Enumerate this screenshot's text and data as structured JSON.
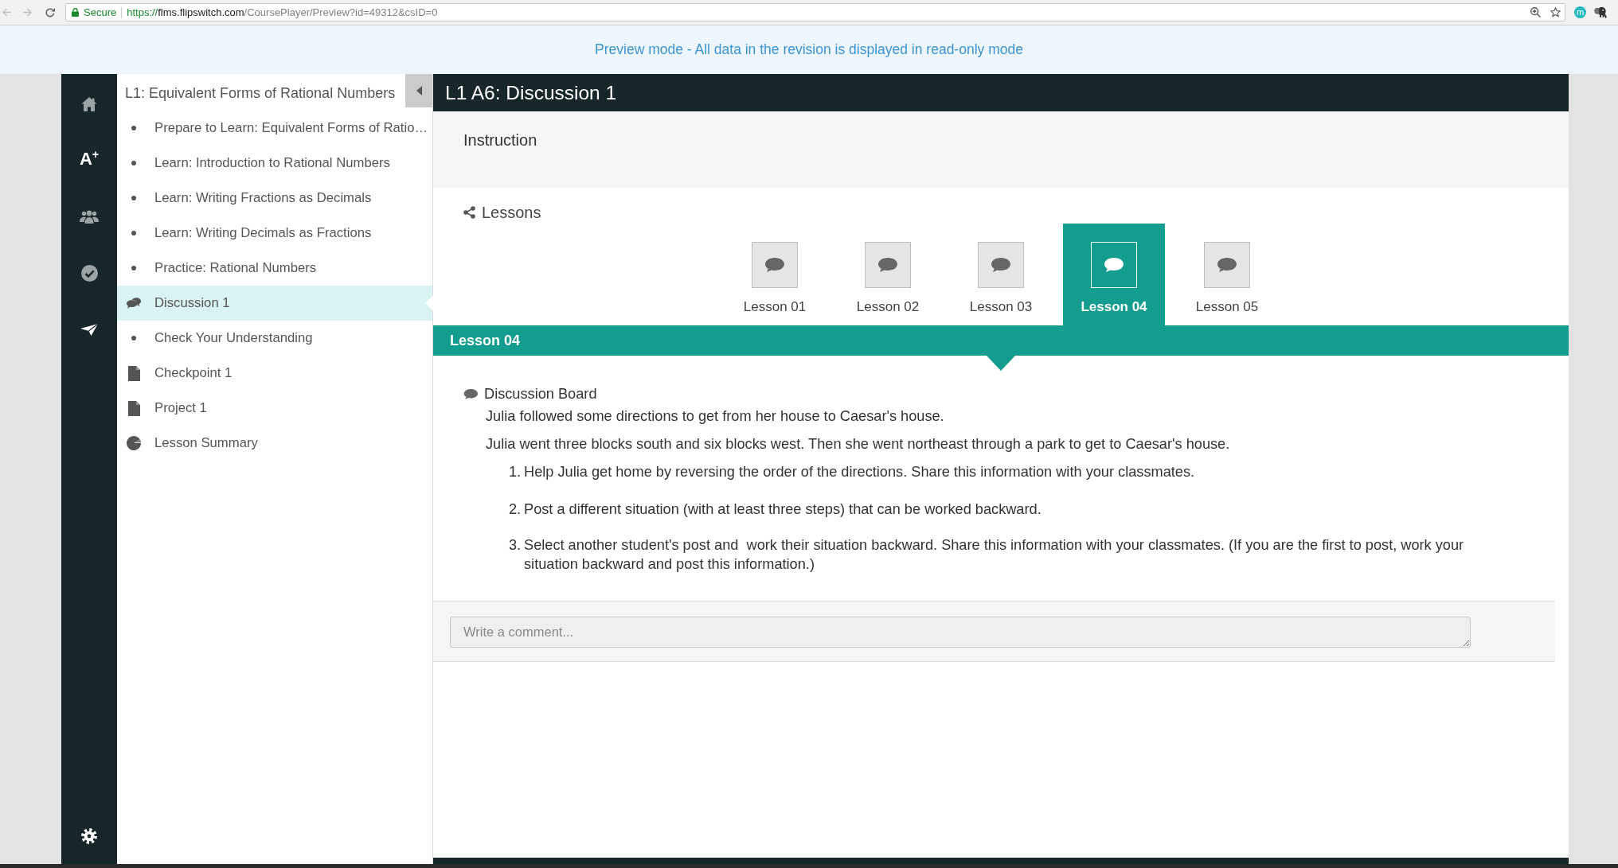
{
  "browser": {
    "security_label": "Secure",
    "url": {
      "scheme": "https://",
      "host": "flms.flipswitch.com",
      "path": "/CoursePlayer/Preview?id=49312&csID=0"
    },
    "extension_badge": "m"
  },
  "banner": {
    "text": "Preview mode - All data in the revision is displayed in read-only mode"
  },
  "nav_rail": {
    "grades_glyph": "A$^{+}$"
  },
  "sidebar": {
    "title": "L1: Equivalent Forms of Rational Numbers",
    "items": [
      {
        "kind": "bullet",
        "label": "Prepare to Learn: Equivalent Forms of Ratio…",
        "selected": false
      },
      {
        "kind": "bullet",
        "label": "Learn: Introduction to Rational Numbers",
        "selected": false
      },
      {
        "kind": "bullet",
        "label": "Learn: Writing Fractions as Decimals",
        "selected": false
      },
      {
        "kind": "bullet",
        "label": "Learn: Writing Decimals as Fractions",
        "selected": false
      },
      {
        "kind": "bullet",
        "label": "Practice: Rational Numbers",
        "selected": false
      },
      {
        "kind": "discussion",
        "label": "Discussion 1",
        "selected": true
      },
      {
        "kind": "bullet",
        "label": "Check Your Understanding",
        "selected": false
      },
      {
        "kind": "document",
        "label": "Checkpoint 1",
        "selected": false
      },
      {
        "kind": "document",
        "label": "Project 1",
        "selected": false
      },
      {
        "kind": "summary",
        "label": "Lesson Summary",
        "selected": false
      }
    ]
  },
  "activity": {
    "title": "L1 A6: Discussion 1",
    "instruction_heading": "Instruction",
    "lessons_heading": "Lessons",
    "lesson_tabs": [
      {
        "label": "Lesson 01",
        "selected": false
      },
      {
        "label": "Lesson 02",
        "selected": false
      },
      {
        "label": "Lesson 03",
        "selected": false
      },
      {
        "label": "Lesson 04",
        "selected": true
      },
      {
        "label": "Lesson 05",
        "selected": false
      }
    ],
    "band_title": "Lesson 04",
    "discussion": {
      "heading": "Discussion Board",
      "paragraphs": [
        "Julia followed some directions to get from her house to Caesar's house.",
        "Julia went three blocks south and six blocks west. Then she went northeast through a park to get to Caesar's house."
      ],
      "steps": [
        {
          "number": "1.",
          "text": "Help Julia get home by reversing the order of the directions. Share this information with your classmates."
        },
        {
          "number": "2.",
          "text": "Post a different situation (with at least three steps) that can be worked backward."
        },
        {
          "number": "3.",
          "text": "Select another student's post and  work their situation backward. Share this information with your classmates. (If you are the first to post, work your situation backward and post this information.)"
        }
      ]
    },
    "comment": {
      "placeholder": "Write a comment..."
    }
  }
}
